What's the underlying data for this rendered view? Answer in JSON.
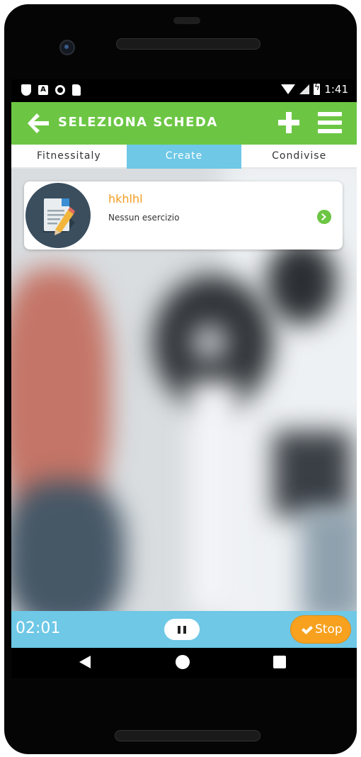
{
  "statusbar": {
    "time": "1:41",
    "a_glyph": "A"
  },
  "header": {
    "title": "SELEZIONA SCHEDA",
    "back_icon": "arrow-left-icon",
    "add_icon": "plus-icon",
    "menu_icon": "hamburger-menu-icon"
  },
  "tabs": [
    {
      "label": "Fitnessitaly",
      "active": false
    },
    {
      "label": "Create",
      "active": true
    },
    {
      "label": "Condivise",
      "active": false
    }
  ],
  "cards": [
    {
      "title": "hkhlhl",
      "subtitle": "Nessun esercizio",
      "icon": "document-pencil-icon",
      "action_icon": "chevron-right-circle-icon"
    }
  ],
  "timer": {
    "elapsed": "02:01",
    "pause_icon": "pause-icon",
    "stop_label": "Stop",
    "stop_icon": "check-icon"
  },
  "colors": {
    "header_green": "#6cc644",
    "tab_active_blue": "#6ec8e6",
    "card_title_orange": "#f39c1f",
    "stop_orange": "#f7a11f"
  }
}
